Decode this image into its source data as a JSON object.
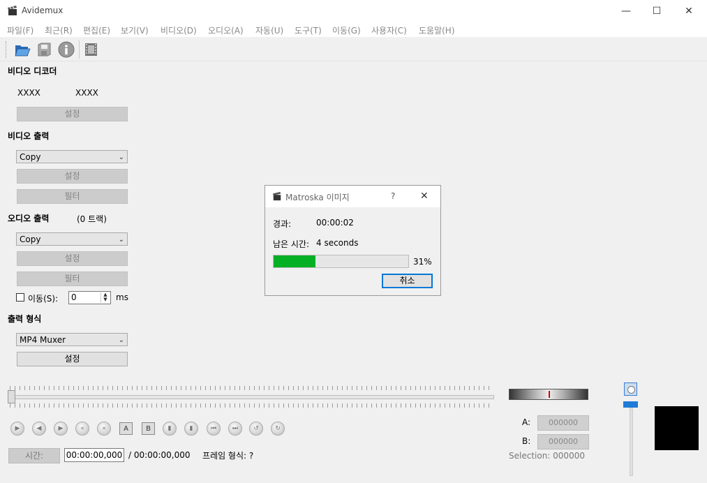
{
  "window": {
    "title": "Avidemux",
    "minimize": "—",
    "maximize": "☐",
    "close": "✕"
  },
  "menu": [
    "파일(F)",
    "최근(R)",
    "편집(E)",
    "보기(V)",
    "비디오(D)",
    "오디오(A)",
    "자동(U)",
    "도구(T)",
    "이동(G)",
    "사용자(C)",
    "도움말(H)"
  ],
  "toolbar": {
    "icons": [
      "open-folder-icon",
      "save-disk-icon",
      "info-icon",
      "film-icon"
    ]
  },
  "video_decoder": {
    "title": "비디오 디코더",
    "decoder_a": "XXXX",
    "decoder_b": "XXXX",
    "settings_label": "설정"
  },
  "video_output": {
    "title": "비디오 출력",
    "codec": "Copy",
    "settings_label": "설정",
    "filters_label": "필터"
  },
  "audio_output": {
    "title": "오디오 출력",
    "tracks": "(0 트랙)",
    "codec": "Copy",
    "settings_label": "설정",
    "filters_label": "필터",
    "shift_label": "이동(S):",
    "shift_checked": false,
    "shift_value": "0",
    "shift_unit": "ms"
  },
  "output_format": {
    "title": "출력 형식",
    "muxer": "MP4 Muxer",
    "settings_label": "설정"
  },
  "transport": {
    "time_label": "시간:",
    "current_time": "00:00:00,000",
    "total_time": "/ 00:00:00,000",
    "frame_type_label": "프레임 형식: ?",
    "a_label": "A:",
    "a_value": "000000",
    "b_label": "B:",
    "b_value": "000000",
    "selection": "Selection: 000000",
    "marker_a": "A",
    "marker_b": "B"
  },
  "dialog": {
    "title": "Matroska 이미지",
    "help": "?",
    "close": "✕",
    "elapsed_label": "경과:",
    "elapsed_value": "00:00:02",
    "remaining_label": "남은 시간:",
    "remaining_value": "4 seconds",
    "progress": 0.31,
    "progress_text": "31%",
    "cancel_label": "취소"
  },
  "colors": {
    "progress_fill": "#06b025",
    "focus_border": "#0078d7"
  }
}
